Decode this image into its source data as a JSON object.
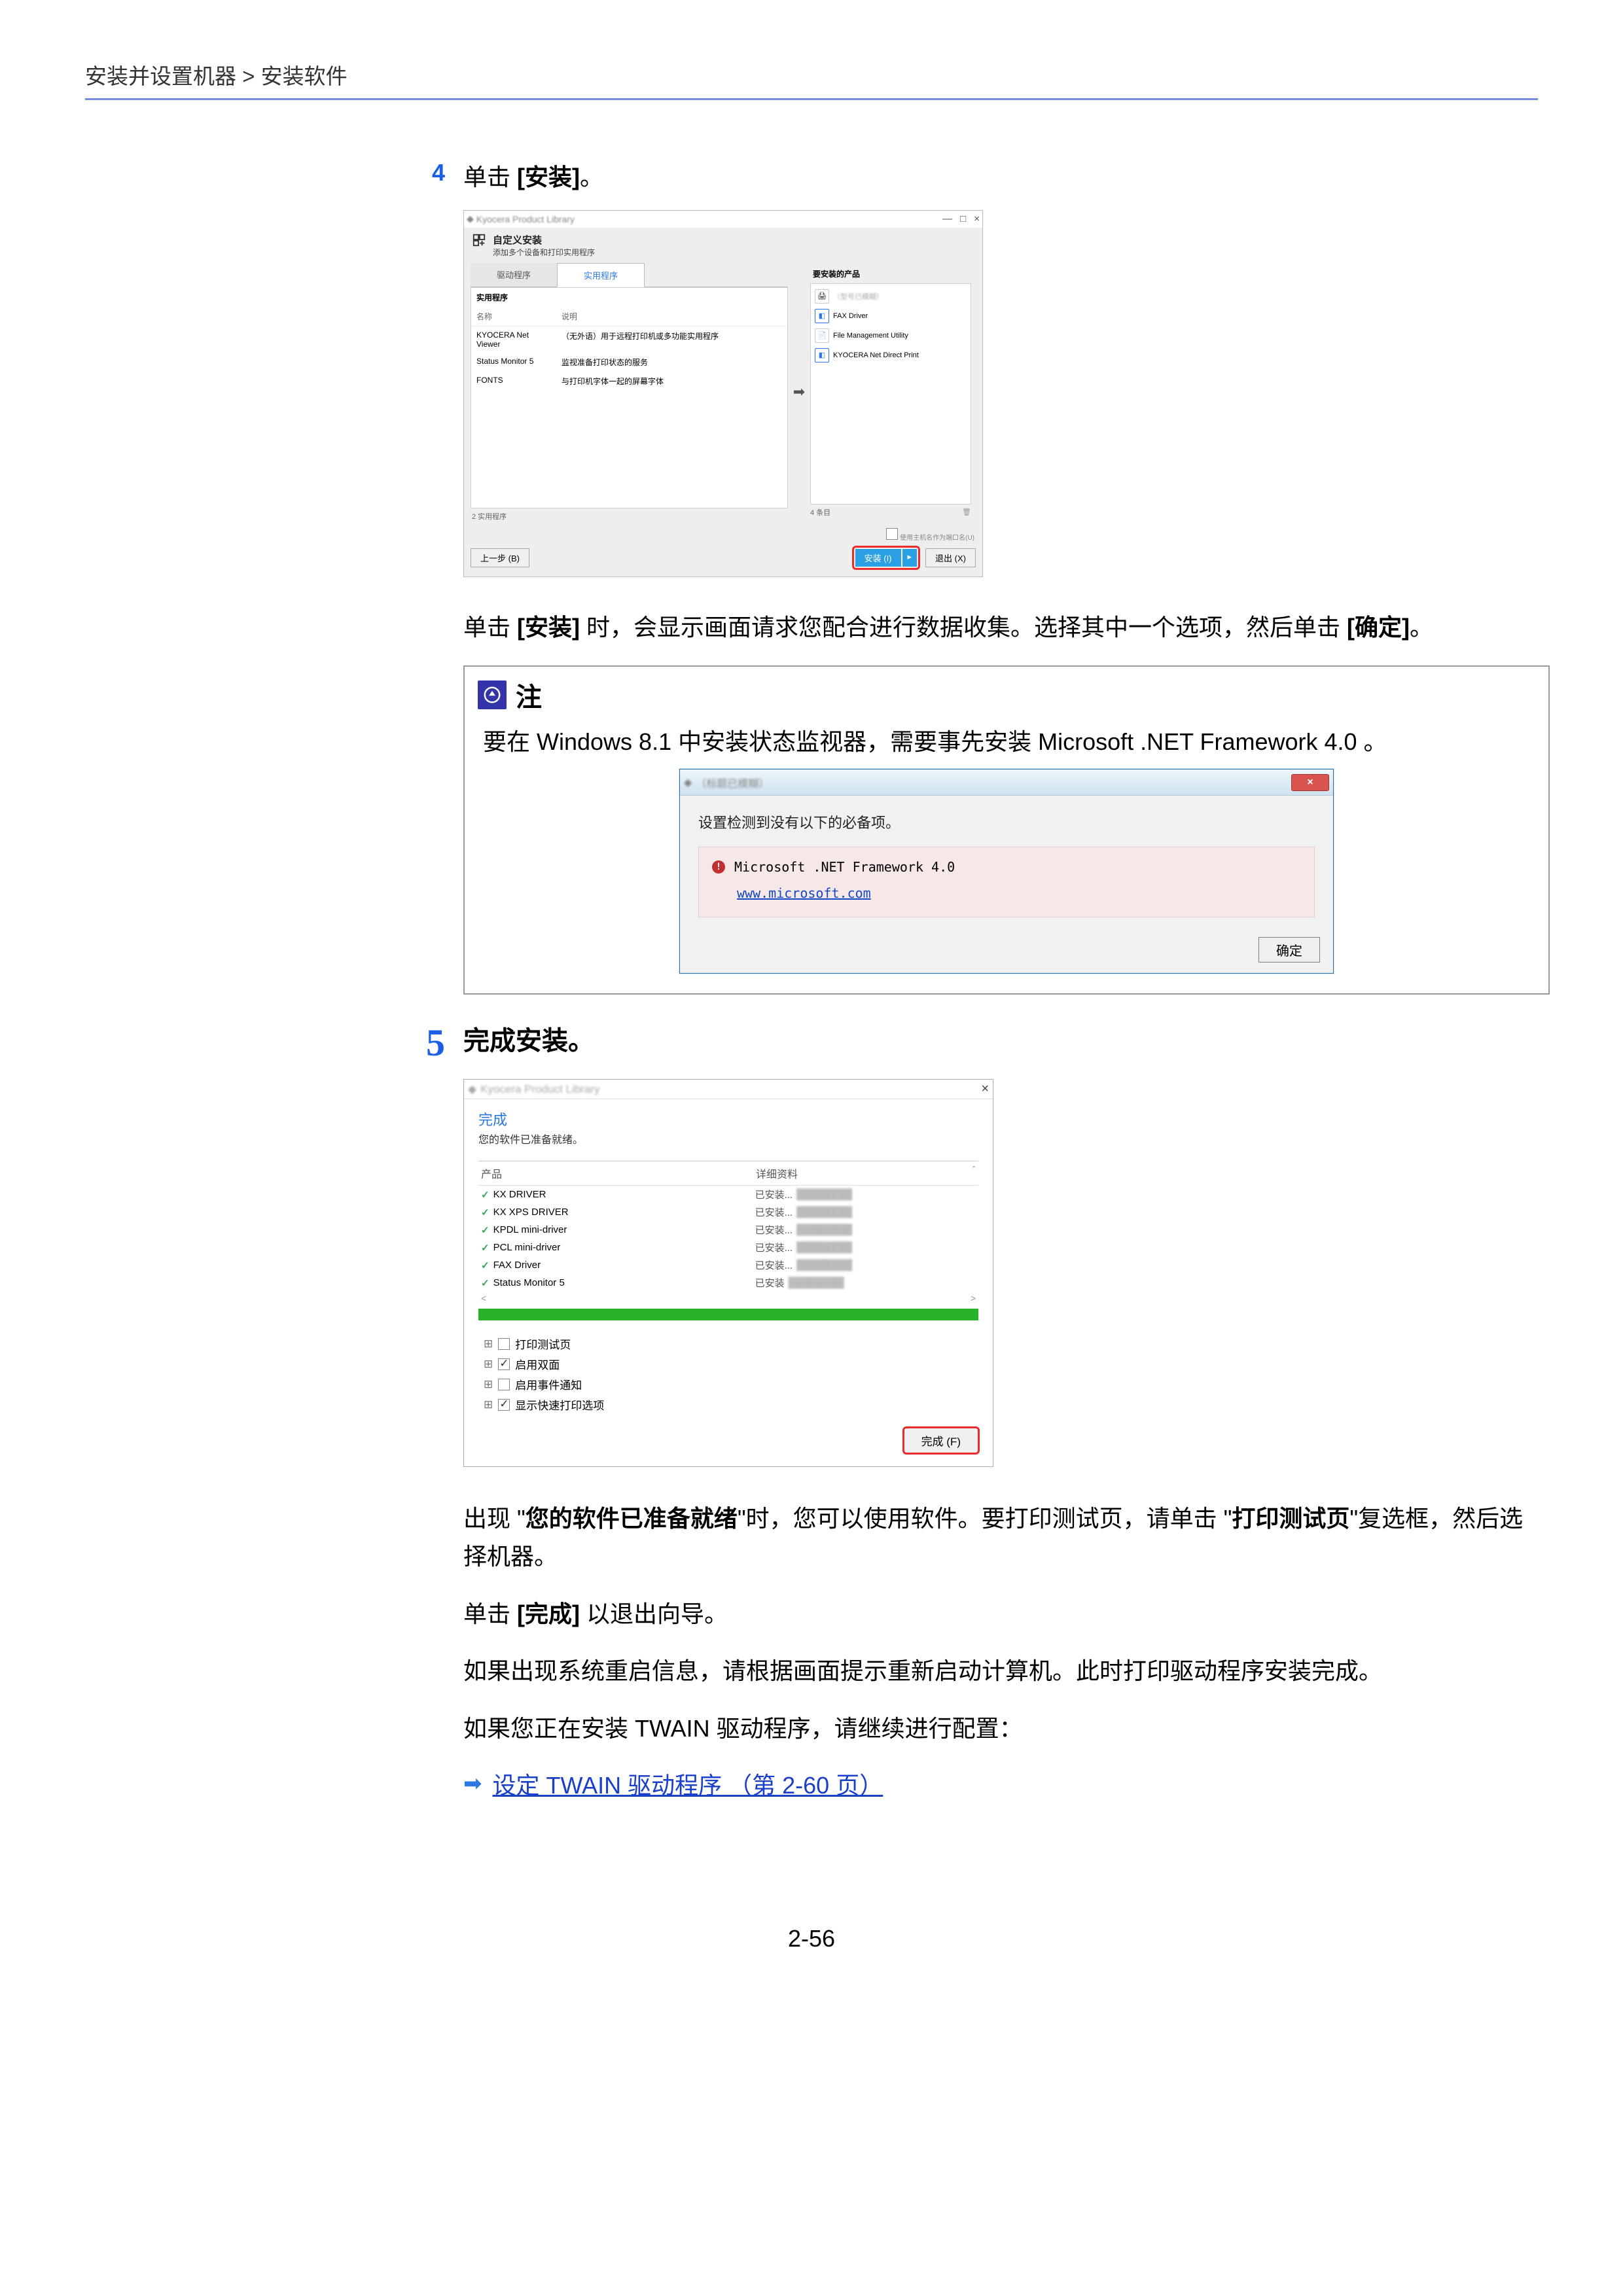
{
  "breadcrumb": "安装并设置机器 > 安装软件",
  "step4": {
    "num": "4",
    "text_prefix": "单击 ",
    "text_bold": "[安装]",
    "text_suffix": "。"
  },
  "dlg1": {
    "title_blur": "Kyocera Product Library",
    "win_min": "—",
    "win_max": "□",
    "win_close": "×",
    "header_title": "自定义安装",
    "header_sub": "添加多个设备和打印实用程序",
    "tab_drivers": "驱动程序",
    "tab_util": "实用程序",
    "left_group": "实用程序",
    "col_name": "名称",
    "col_desc": "说明",
    "rows": [
      {
        "n": "KYOCERA Net Viewer",
        "d": "（无外语）用于远程打印机或多功能实用程序"
      },
      {
        "n": "Status Monitor 5",
        "d": "监视准备打印状态的服务"
      },
      {
        "n": "FONTS",
        "d": "与打印机字体一起的屏幕字体"
      }
    ],
    "foot_left": "2 实用程序",
    "right_head": "要安装的产品",
    "prods": [
      {
        "icon": "printer",
        "label_blur": "（型号已模糊）"
      },
      {
        "icon": "blue",
        "label": "FAX Driver"
      },
      {
        "icon": "util",
        "label": "File Management Utility"
      },
      {
        "icon": "blue",
        "label": "KYOCERA Net Direct Print"
      }
    ],
    "right_count": "4 条目",
    "right_check_label": "使用主机名作为端口名(U)",
    "btn_back": "上一步 (B)",
    "btn_install": "安装 (I)",
    "btn_more": "▸",
    "btn_exit": "退出 (X)"
  },
  "para_after_dlg1_a": "单击 ",
  "para_after_dlg1_bold1": "[安装]",
  "para_after_dlg1_b": " 时，会显示画面请求您配合进行数据收集。选择其中一个选项，然后单击 ",
  "para_after_dlg1_bold2": "[确定]",
  "para_after_dlg1_c": "。",
  "note": {
    "title": "注",
    "text": "要在 Windows 8.1 中安装状态监视器，需要事先安装 Microsoft .NET Framework 4.0 。"
  },
  "dlg2": {
    "title_blur": "（标题已模糊）",
    "close": "×",
    "msg": "设置检测到没有以下的必备项。",
    "req": "Microsoft .NET Framework 4.0",
    "link": "www.microsoft.com",
    "ok": "确定"
  },
  "step5": {
    "num": "5",
    "title": "完成安装。"
  },
  "dlg3": {
    "title_blur": "Kyocera Product Library",
    "close": "×",
    "t1": "完成",
    "t2": "您的软件已准备就绪。",
    "col_prod": "产品",
    "col_detail": "详细资料",
    "rows": [
      {
        "n": "KX DRIVER",
        "s": "已安装..."
      },
      {
        "n": "KX XPS DRIVER",
        "s": "已安装..."
      },
      {
        "n": "KPDL mini-driver",
        "s": "已安装..."
      },
      {
        "n": "PCL mini-driver",
        "s": "已安装..."
      },
      {
        "n": "FAX Driver",
        "s": "已安装..."
      },
      {
        "n": "Status Monitor 5",
        "s": "已安装"
      }
    ],
    "scroll_left": "<",
    "scroll_right": ">",
    "opts": [
      {
        "checked": false,
        "label": "打印测试页"
      },
      {
        "checked": true,
        "label": "启用双面"
      },
      {
        "checked": false,
        "label": "启用事件通知"
      },
      {
        "checked": true,
        "label": "显示快速打印选项"
      }
    ],
    "btn_done": "完成 (F)"
  },
  "para5a_a": "出现 \"",
  "para5a_bold1": "您的软件已准备就绪",
  "para5a_b": "\"时，您可以使用软件。要打印测试页，请单击 \"",
  "para5a_bold2": "打印测试页",
  "para5a_c": "\"复选框，然后选择机器。",
  "para5b_a": "单击 ",
  "para5b_bold": "[完成]",
  "para5b_b": " 以退出向导。",
  "para5c": "如果出现系统重启信息，请根据画面提示重新启动计算机。此时打印驱动程序安装完成。",
  "para5d": "如果您正在安装 TWAIN 驱动程序，请继续进行配置：",
  "link_text": "设定 TWAIN 驱动程序 （第 2-60 页）",
  "page_num": "2-56"
}
